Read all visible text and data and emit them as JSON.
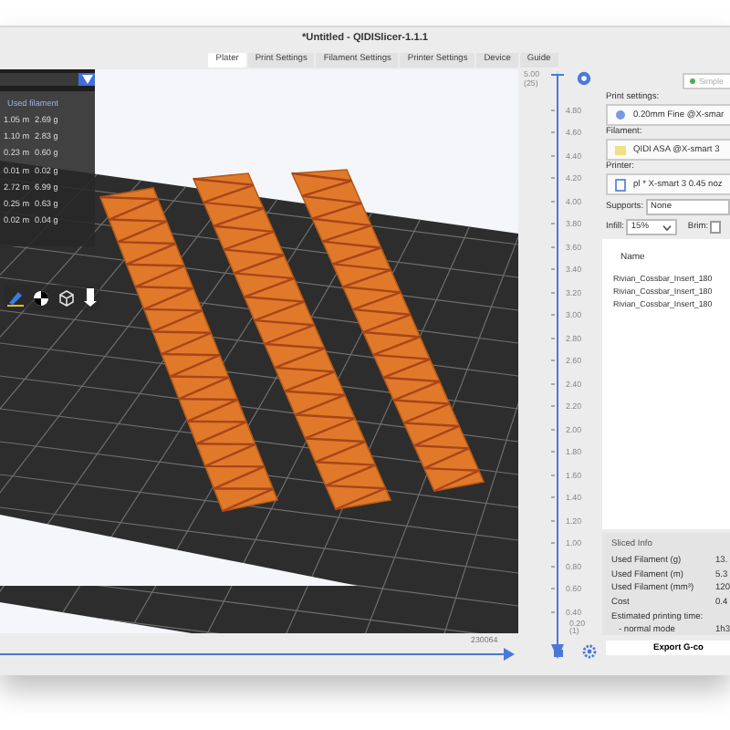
{
  "window": {
    "title": "*Untitled - QIDISlicer-1.1.1"
  },
  "tabs": [
    {
      "label": "Plater",
      "selected": true
    },
    {
      "label": "Print Settings",
      "selected": false
    },
    {
      "label": "Filament Settings",
      "selected": false
    },
    {
      "label": "Printer Settings",
      "selected": false
    },
    {
      "label": "Device",
      "selected": false
    },
    {
      "label": "Guide",
      "selected": false
    }
  ],
  "filament_panel": {
    "header": "Used filament",
    "rows": [
      {
        "length": "1.05 m",
        "weight": "2.69 g"
      },
      {
        "length": "1.10 m",
        "weight": "2.83 g"
      },
      {
        "length": "0.23 m",
        "weight": "0.60 g"
      },
      {
        "length": "0.01 m",
        "weight": "0.02 g"
      },
      {
        "length": "2.72 m",
        "weight": "6.99 g"
      },
      {
        "length": "0.25 m",
        "weight": "0.63 g"
      },
      {
        "length": "0.02 m",
        "weight": "0.04 g"
      }
    ]
  },
  "vertical_slider": {
    "level": 1,
    "top_value": "5.00",
    "top_layer": "(25)",
    "ticks": [
      "4.80",
      "4.60",
      "4.40",
      "4.20",
      "4.00",
      "3.80",
      "3.60",
      "3.40",
      "3.20",
      "3.00",
      "2.80",
      "2.60",
      "2.40",
      "2.20",
      "2.00",
      "1.80",
      "1.60",
      "1.40",
      "1.20",
      "1.00",
      "0.80",
      "0.60",
      "0.40"
    ],
    "bottom_value": "0.20",
    "bottom_layer": "(1)"
  },
  "horizontal_slider": {
    "label": "230064",
    "level": 1
  },
  "right_panel": {
    "mode_button": "Simple",
    "print_settings": {
      "label": "Print settings:",
      "value": "0.20mm Fine @X-smar"
    },
    "filament": {
      "label": "Filament:",
      "value": "QIDI ASA @X-smart 3"
    },
    "printer": {
      "label": "Printer:",
      "value": "pl * X-smart 3 0.45 noz"
    },
    "supports": {
      "label": "Supports:",
      "value": "None"
    },
    "infill": {
      "label": "Infill:",
      "value": "15%"
    },
    "brim": {
      "label": "Brim:",
      "checked": false
    },
    "objects": {
      "column": "Name",
      "rows": [
        "Rivian_Cossbar_Insert_180",
        "Rivian_Cossbar_Insert_180",
        "Rivian_Cossbar_Insert_180"
      ]
    },
    "sliced_info": {
      "title": "Sliced Info",
      "rows": [
        {
          "label": "Used Filament (g)",
          "value": "13."
        },
        {
          "label": "Used Filament (m)",
          "value": "5.3"
        },
        {
          "label": "Used Filament (mm³)",
          "value": "120"
        },
        {
          "label": "Cost",
          "value": "0.4"
        }
      ],
      "time_label": "Estimated printing time:",
      "mode_label": "- normal mode",
      "mode_value": "1h3"
    },
    "export_button": "Export G-co"
  }
}
